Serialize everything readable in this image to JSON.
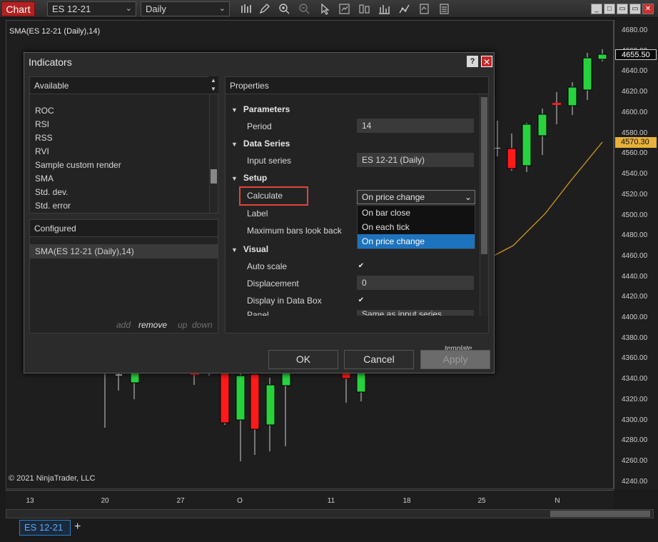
{
  "toolbar": {
    "chart_label": "Chart",
    "instrument": "ES 12-21",
    "interval": "Daily",
    "dropdown_arrow": "⌄",
    "icons": [
      "bar-chart-icon",
      "pencil-icon",
      "zoom-in-icon",
      "zoom-out-icon",
      "pointer-icon",
      "data-box-icon",
      "indicators-icon",
      "strategies-icon",
      "drawing-tools-icon",
      "properties-icon",
      "templates-icon"
    ],
    "window": {
      "minimize": "_",
      "restore": "□",
      "maximize": "▭",
      "close": "✕"
    }
  },
  "chart": {
    "title": "SMA(ES 12-21 (Daily),14)",
    "copyright": "© 2021 NinjaTrader, LLC",
    "colors": {
      "up": "#27d33d",
      "down": "#ff1a1a",
      "sma": "#d49a22",
      "flag_sma": "#e8b23a"
    },
    "last_price": "4655.50",
    "sma_price": "4570.30",
    "price_ticks": [
      "4680.00",
      "4660.00",
      "4640.00",
      "4620.00",
      "4600.00",
      "4580.00",
      "4560.00",
      "4540.00",
      "4520.00",
      "4500.00",
      "4480.00",
      "4460.00",
      "4440.00",
      "4420.00",
      "4400.00",
      "4380.00",
      "4360.00",
      "4340.00",
      "4320.00",
      "4300.00",
      "4280.00",
      "4260.00",
      "4240.00"
    ],
    "time_ticks": [
      "13",
      "20",
      "27",
      "O",
      "11",
      "18",
      "25",
      "N"
    ]
  },
  "tabs": [
    {
      "label": "ES 12-21"
    }
  ],
  "tab_add": "+",
  "dialog": {
    "title": "Indicators",
    "help": "?",
    "close": "✕",
    "available": {
      "header": "Available",
      "info": "i",
      "items": [
        "ROC",
        "RSI",
        "RSS",
        "RVI",
        "Sample custom render",
        "SMA",
        "Std. dev.",
        "Std. error"
      ]
    },
    "configured": {
      "header": "Configured",
      "items": [
        "SMA(ES 12-21 (Daily),14)"
      ],
      "actions": {
        "add": "add",
        "remove": "remove",
        "up": "up",
        "down": "down"
      }
    },
    "properties": {
      "header": "Properties",
      "categories": {
        "parameters": "Parameters",
        "data_series": "Data Series",
        "setup": "Setup",
        "visual": "Visual"
      },
      "rows": {
        "period_label": "Period",
        "period_value": "14",
        "input_series_label": "Input series",
        "input_series_value": "ES 12-21 (Daily)",
        "calculate_label": "Calculate",
        "calculate_value": "On price change",
        "label_label": "Label",
        "max_bars_label": "Maximum bars look back",
        "auto_scale_label": "Auto scale",
        "displacement_label": "Displacement",
        "displacement_value": "0",
        "display_data_box_label": "Display in Data Box",
        "panel_label": "Panel",
        "panel_value": "Same as input series"
      },
      "calculate_options": [
        "On bar close",
        "On each tick",
        "On price change"
      ],
      "selected_option_index": 2,
      "check_mark": "✔",
      "template": "template"
    },
    "buttons": {
      "ok": "OK",
      "cancel": "Cancel",
      "apply": "Apply"
    }
  }
}
